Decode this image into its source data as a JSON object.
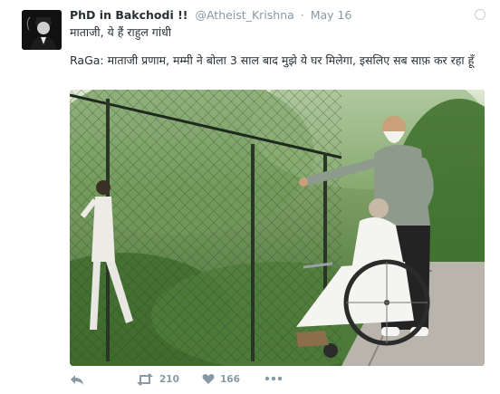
{
  "tweet": {
    "display_name": "PhD in Bakchodi !!",
    "handle": "@Atheist_Krishna",
    "separator": "·",
    "date": "May 16",
    "line1": "माताजी, ये हैं राहुल गांधी",
    "line2": "RaGa: माताजी प्रणाम, मम्मी ने बोला 3 साल बाद मुझे ये घर मिलेगा, इसलिए सब साफ़ कर रहा हूँ",
    "retweet_count": "210",
    "like_count": "166"
  },
  "icons": {
    "reply": "reply-icon",
    "retweet": "retweet-icon",
    "like": "heart-icon",
    "more": "more-icon",
    "caret": "caret-icon"
  },
  "colors": {
    "text": "#292f33",
    "muted": "#8899a6"
  }
}
